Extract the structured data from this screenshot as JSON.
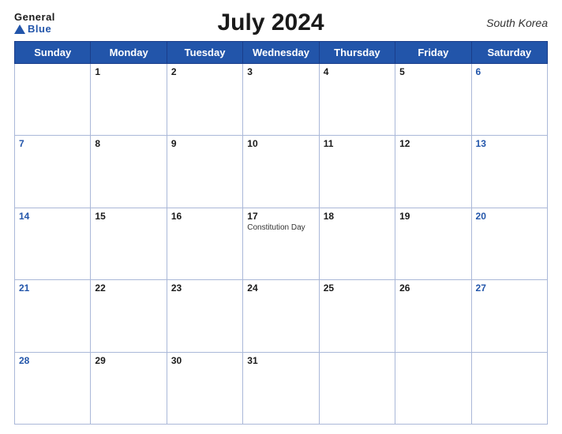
{
  "header": {
    "logo_general": "General",
    "logo_blue": "Blue",
    "title": "July 2024",
    "country": "South Korea"
  },
  "days_of_week": [
    "Sunday",
    "Monday",
    "Tuesday",
    "Wednesday",
    "Thursday",
    "Friday",
    "Saturday"
  ],
  "weeks": [
    [
      {
        "day": "",
        "empty": true
      },
      {
        "day": "1"
      },
      {
        "day": "2"
      },
      {
        "day": "3"
      },
      {
        "day": "4"
      },
      {
        "day": "5"
      },
      {
        "day": "6"
      }
    ],
    [
      {
        "day": "7"
      },
      {
        "day": "8"
      },
      {
        "day": "9"
      },
      {
        "day": "10"
      },
      {
        "day": "11"
      },
      {
        "day": "12"
      },
      {
        "day": "13"
      }
    ],
    [
      {
        "day": "14"
      },
      {
        "day": "15"
      },
      {
        "day": "16"
      },
      {
        "day": "17",
        "event": "Constitution Day"
      },
      {
        "day": "18"
      },
      {
        "day": "19"
      },
      {
        "day": "20"
      }
    ],
    [
      {
        "day": "21"
      },
      {
        "day": "22"
      },
      {
        "day": "23"
      },
      {
        "day": "24"
      },
      {
        "day": "25"
      },
      {
        "day": "26"
      },
      {
        "day": "27"
      }
    ],
    [
      {
        "day": "28"
      },
      {
        "day": "29"
      },
      {
        "day": "30"
      },
      {
        "day": "31"
      },
      {
        "day": "",
        "empty": true
      },
      {
        "day": "",
        "empty": true
      },
      {
        "day": "",
        "empty": true
      }
    ]
  ],
  "events": {
    "17": "Constitution Day"
  }
}
